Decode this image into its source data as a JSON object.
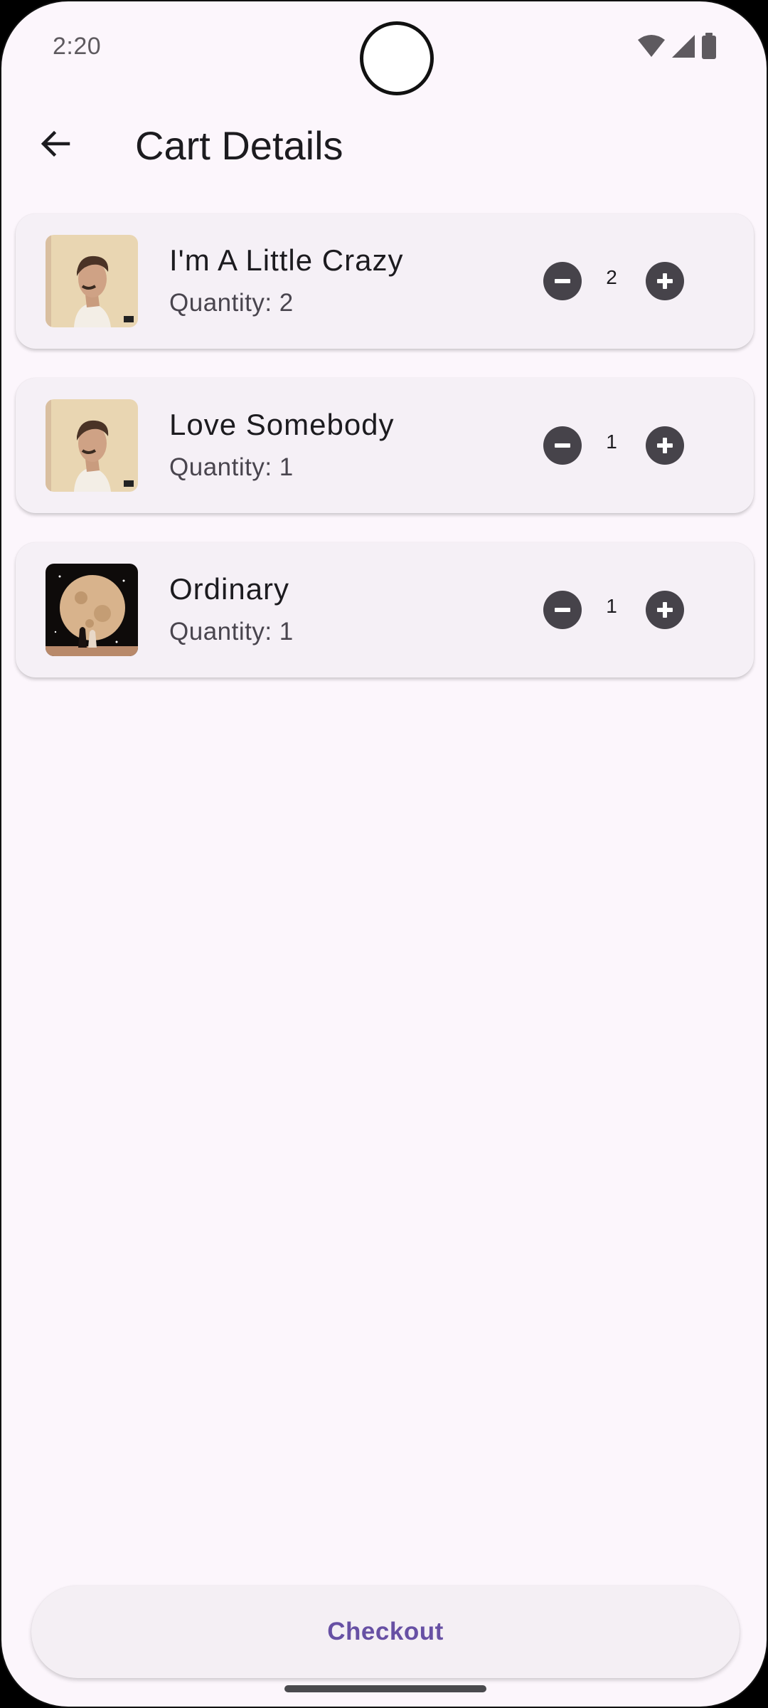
{
  "status_bar": {
    "time": "2:20",
    "icons": [
      "wifi-icon",
      "cellular-signal-icon",
      "battery-icon"
    ]
  },
  "app_bar": {
    "back_icon": "arrow-back-icon",
    "title": "Cart Details"
  },
  "cart": {
    "items": [
      {
        "title": "I'm A Little Crazy",
        "quantity_text": "Quantity: 2",
        "quantity": "2",
        "art": "portrait-album-art"
      },
      {
        "title": "Love Somebody",
        "quantity_text": "Quantity: 1",
        "quantity": "1",
        "art": "portrait-album-art"
      },
      {
        "title": "Ordinary",
        "quantity_text": "Quantity: 1",
        "quantity": "1",
        "art": "moon-album-art"
      }
    ]
  },
  "checkout": {
    "label": "Checkout"
  },
  "colors": {
    "background": "#FCF6FC",
    "card": "#F5F0F6",
    "stepper": "#46434A",
    "accent": "#6750A4"
  }
}
